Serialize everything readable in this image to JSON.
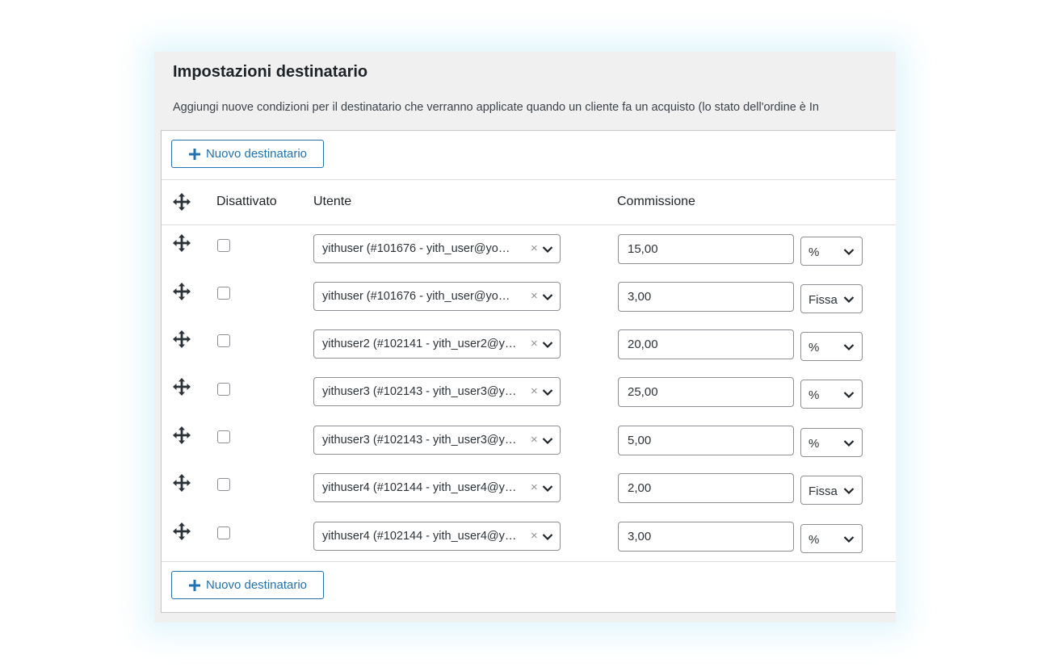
{
  "panel": {
    "title": "Impostazioni destinatario",
    "description": "Aggiungi nuove condizioni per il destinatario che verranno applicate quando un cliente fa un acquisto (lo stato dell'ordine è In"
  },
  "buttons": {
    "add_top": "Nuovo destinatario",
    "add_bottom": "Nuovo destinatario"
  },
  "columns": {
    "disabled": "Disattivato",
    "user": "Utente",
    "commission": "Commissione"
  },
  "rows": [
    {
      "disabled": false,
      "user": "yithuser (#101676 - yith_user@yo…",
      "commission": "15,00",
      "type": "%"
    },
    {
      "disabled": false,
      "user": "yithuser (#101676 - yith_user@yo…",
      "commission": "3,00",
      "type": "Fissa"
    },
    {
      "disabled": false,
      "user": "yithuser2 (#102141 - yith_user2@y…",
      "commission": "20,00",
      "type": "%"
    },
    {
      "disabled": false,
      "user": "yithuser3 (#102143 - yith_user3@y…",
      "commission": "25,00",
      "type": "%"
    },
    {
      "disabled": false,
      "user": "yithuser3 (#102143 - yith_user3@y…",
      "commission": "5,00",
      "type": "%"
    },
    {
      "disabled": false,
      "user": "yithuser4 (#102144 - yith_user4@y…",
      "commission": "2,00",
      "type": "Fissa"
    },
    {
      "disabled": false,
      "user": "yithuser4 (#102144 - yith_user4@y…",
      "commission": "3,00",
      "type": "%"
    }
  ],
  "icons": {
    "move": "move-arrows-icon",
    "plus": "plus-icon",
    "chevron": "chevron-down-icon",
    "clear": "clear-x-icon"
  },
  "colors": {
    "accent": "#2271b1",
    "panel_bg": "#f0f0f1",
    "border": "#8c8f94"
  }
}
